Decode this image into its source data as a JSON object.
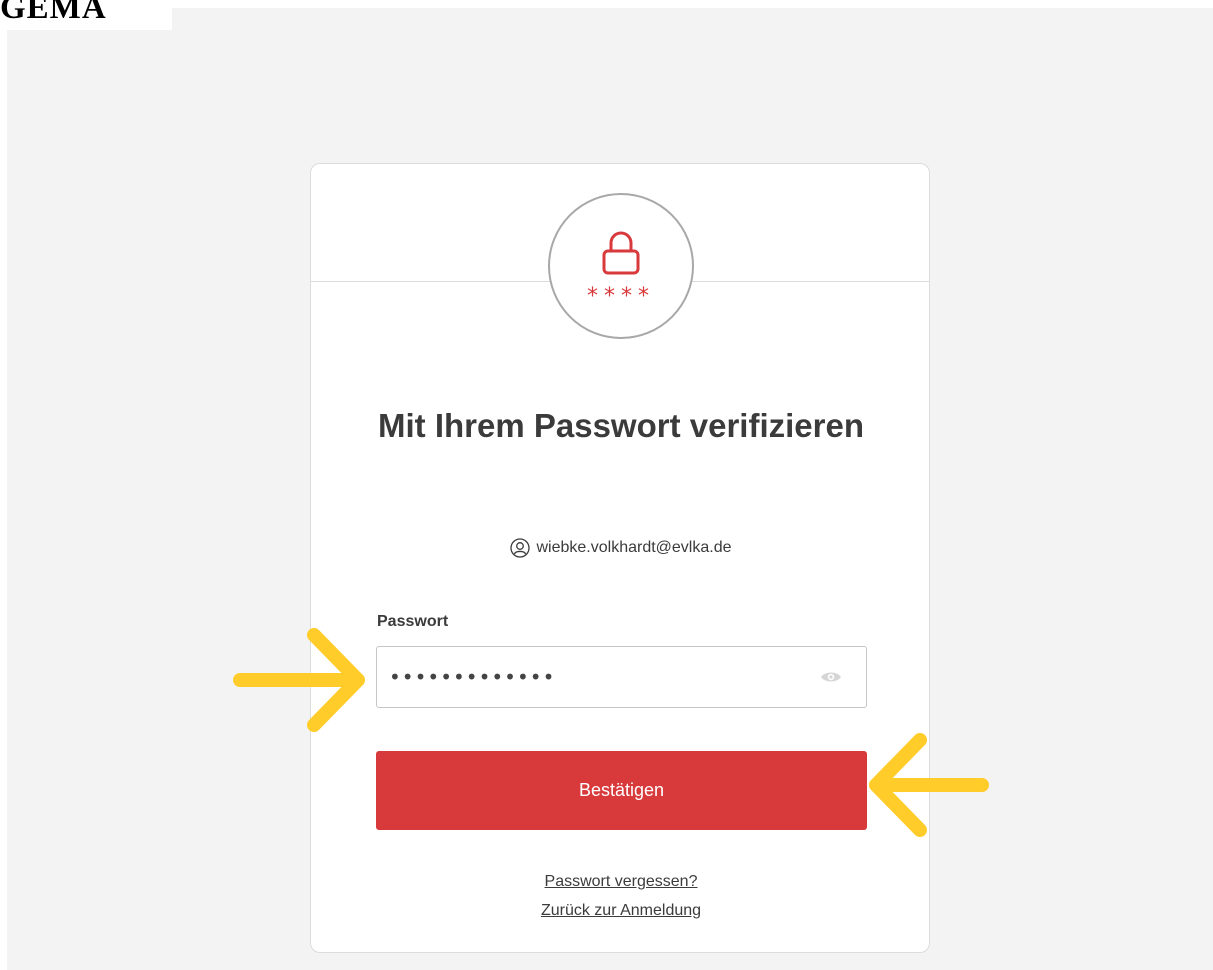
{
  "logo": {
    "text": "GEMA"
  },
  "card": {
    "badge_icon": "lock-icon",
    "badge_mask": "****",
    "title": "Mit Ihrem Passwort verifizieren",
    "identity": {
      "icon": "user-circle-icon",
      "email": "wiebke.volkhardt@evlka.de"
    },
    "password_field": {
      "label": "Passwort",
      "value": "•••••••••••••",
      "visibility_icon": "eye-icon"
    },
    "submit_label": "Bestätigen",
    "links": {
      "forgot": "Passwort vergessen?",
      "back": "Zurück zur Anmeldung"
    }
  },
  "colors": {
    "accent": "#d83a3c",
    "annotation_arrow": "#ffcc2a",
    "page_background": "#f3f3f3",
    "text": "#3b3b3b"
  }
}
